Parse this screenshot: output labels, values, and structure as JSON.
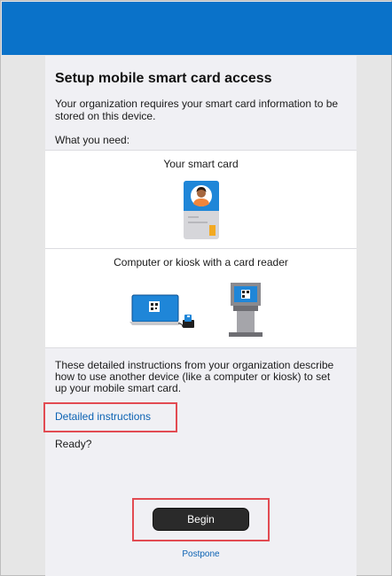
{
  "header": {
    "color": "#0a72c9"
  },
  "sheet": {
    "title": "Setup mobile smart card access",
    "intro": "Your organization requires your smart card information to be stored on this device.",
    "need_label": "What you need:",
    "card_panel": {
      "label": "Your smart card",
      "illustration": "smart-card-illustration"
    },
    "kiosk_panel": {
      "label": "Computer or kiosk with a card reader",
      "illustration": "laptop-and-kiosk-illustration"
    },
    "description": "These detailed instructions from your organization describe how to use another device (like a computer or kiosk) to set up your mobile smart card.",
    "link_label": "Detailed instructions",
    "ready_label": "Ready?",
    "begin_label": "Begin",
    "postpone_label": "Postpone"
  },
  "colors": {
    "accent": "#0a72c9",
    "link": "#0b62b3",
    "highlight": "#e24b52",
    "button": "#2a2a2a"
  }
}
